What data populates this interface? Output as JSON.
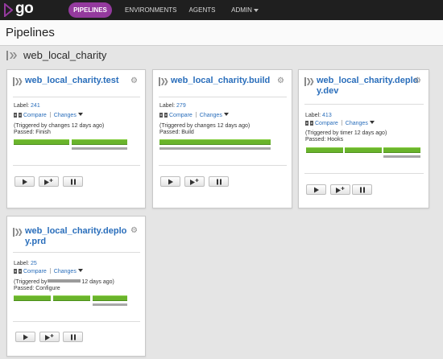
{
  "app": {
    "logo_text": "go",
    "brand_color": "#943a9e"
  },
  "nav": {
    "pipelines": "PIPELINES",
    "environments": "ENVIRONMENTS",
    "agents": "AGENTS",
    "admin": "ADMIN"
  },
  "page": {
    "title": "Pipelines"
  },
  "group": {
    "name": "web_local_charity"
  },
  "pipelines": [
    {
      "name": "web_local_charity.test",
      "label_prefix": "Label: ",
      "label": "241",
      "compare": "Compare",
      "changes": "Changes",
      "triggered": "(Triggered by changes 12 days ago)",
      "passed": "Passed: Finish",
      "stage_status": [
        "passed",
        "passed"
      ]
    },
    {
      "name": "web_local_charity.build",
      "label_prefix": "Label: ",
      "label": "279",
      "compare": "Compare",
      "changes": "Changes",
      "triggered": "(Triggered by changes 12 days ago)",
      "passed": "Passed: Build",
      "stage_status": [
        "passed"
      ]
    },
    {
      "name_line1": "web_local_charity.deplo",
      "name_line2": "y.dev",
      "label_prefix": "Label: ",
      "label": "413",
      "compare": "Compare",
      "changes": "Changes",
      "triggered": "(Triggered by timer 12 days ago)",
      "passed": "Passed: Hooks",
      "stage_status": [
        "passed",
        "passed",
        "passed"
      ]
    },
    {
      "name_line1": "web_local_charity.deplo",
      "name_line2": "y.prd",
      "label_prefix": "Label: ",
      "label": "25",
      "compare": "Compare",
      "changes": "Changes",
      "triggered_prefix": "(Triggered by",
      "triggered_suffix": "12 days ago)",
      "passed": "Passed: Configure",
      "stage_status": [
        "passed",
        "passed",
        "passed"
      ]
    }
  ],
  "colors": {
    "stage_passed": "#6ab42c",
    "link": "#2a6ebb"
  },
  "icons": {
    "trigger": "play-icon",
    "trigger_with_options": "play-plus-icon",
    "pause": "pause-icon",
    "settings": "gear-icon"
  }
}
